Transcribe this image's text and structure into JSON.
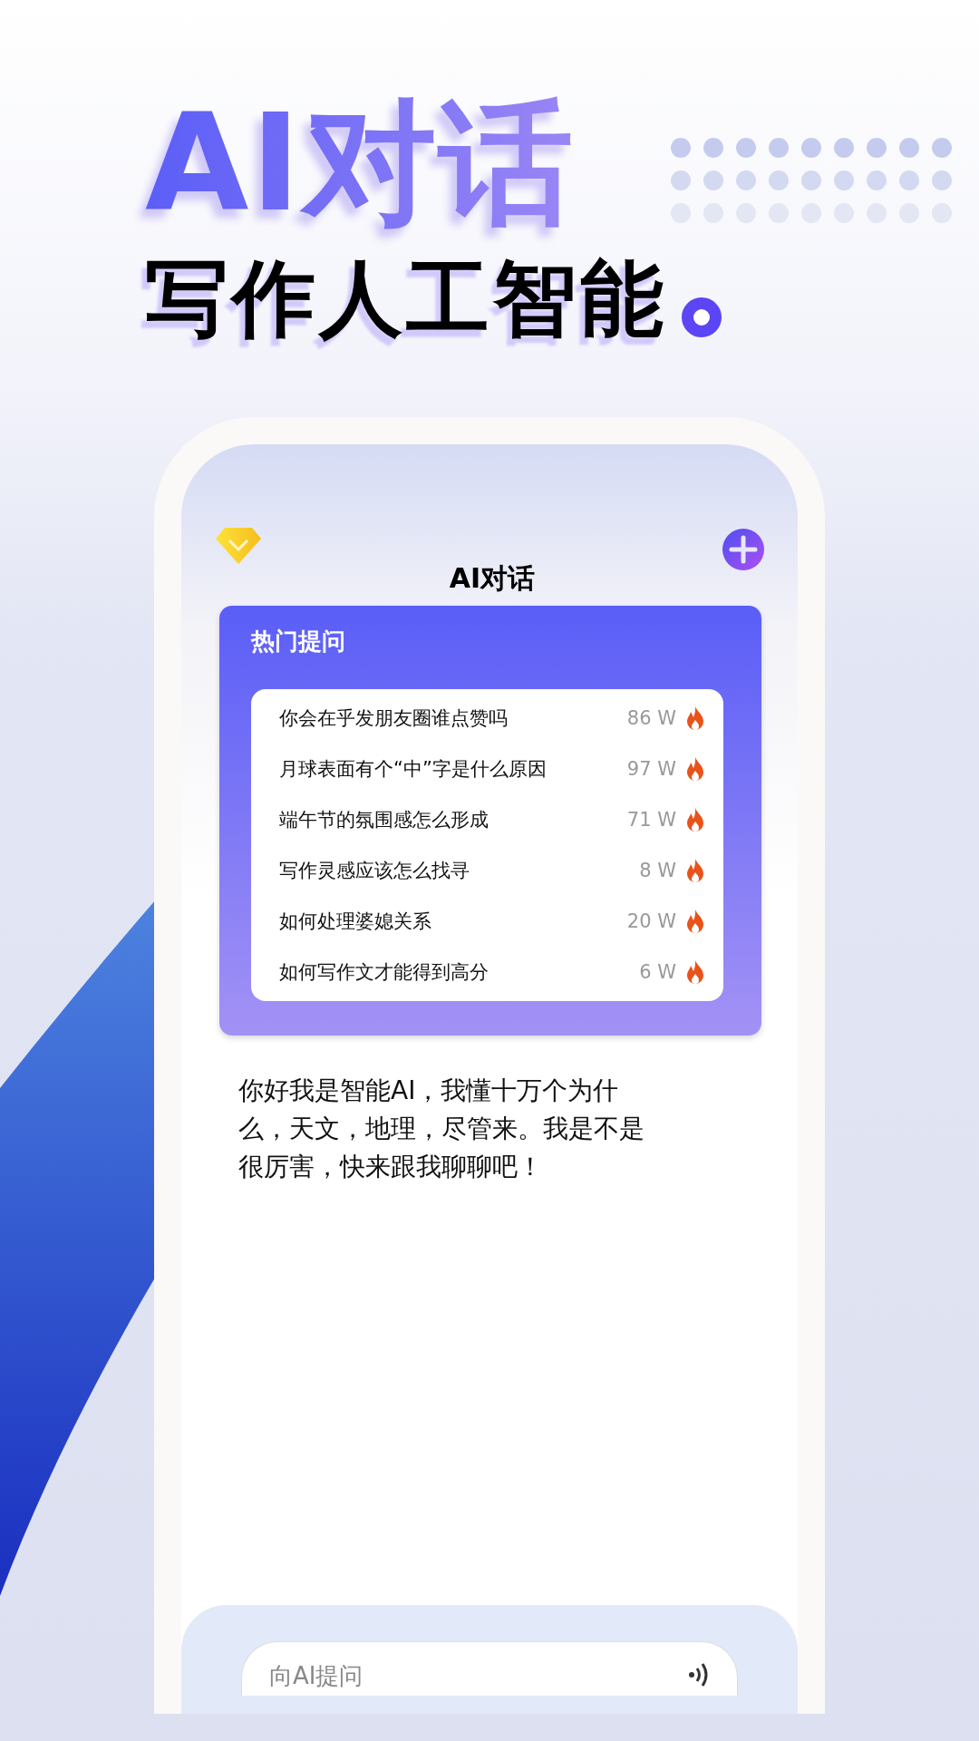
{
  "headline": {
    "title": "AI对话",
    "subtitle": "写作人工智能"
  },
  "app": {
    "title": "AI对话",
    "hot": {
      "title": "热门提问",
      "items": [
        {
          "question": "你会在乎发朋友圈谁点赞吗",
          "count": "86 W"
        },
        {
          "question": "月球表面有个“中”字是什么原因",
          "count": "97 W"
        },
        {
          "question": "端午节的氛围感怎么形成",
          "count": "71 W"
        },
        {
          "question": "写作灵感应该怎么找寻",
          "count": "8 W"
        },
        {
          "question": "如何处理婆媳关系",
          "count": "20 W"
        },
        {
          "question": "如何写作文才能得到高分",
          "count": "6 W"
        }
      ]
    },
    "greeting": "你好我是智能AI，我懂十万个为什么，天文，地理，尽管来。我是不是很厉害，快来跟我聊聊吧！",
    "input": {
      "placeholder": "向AI提问"
    }
  }
}
